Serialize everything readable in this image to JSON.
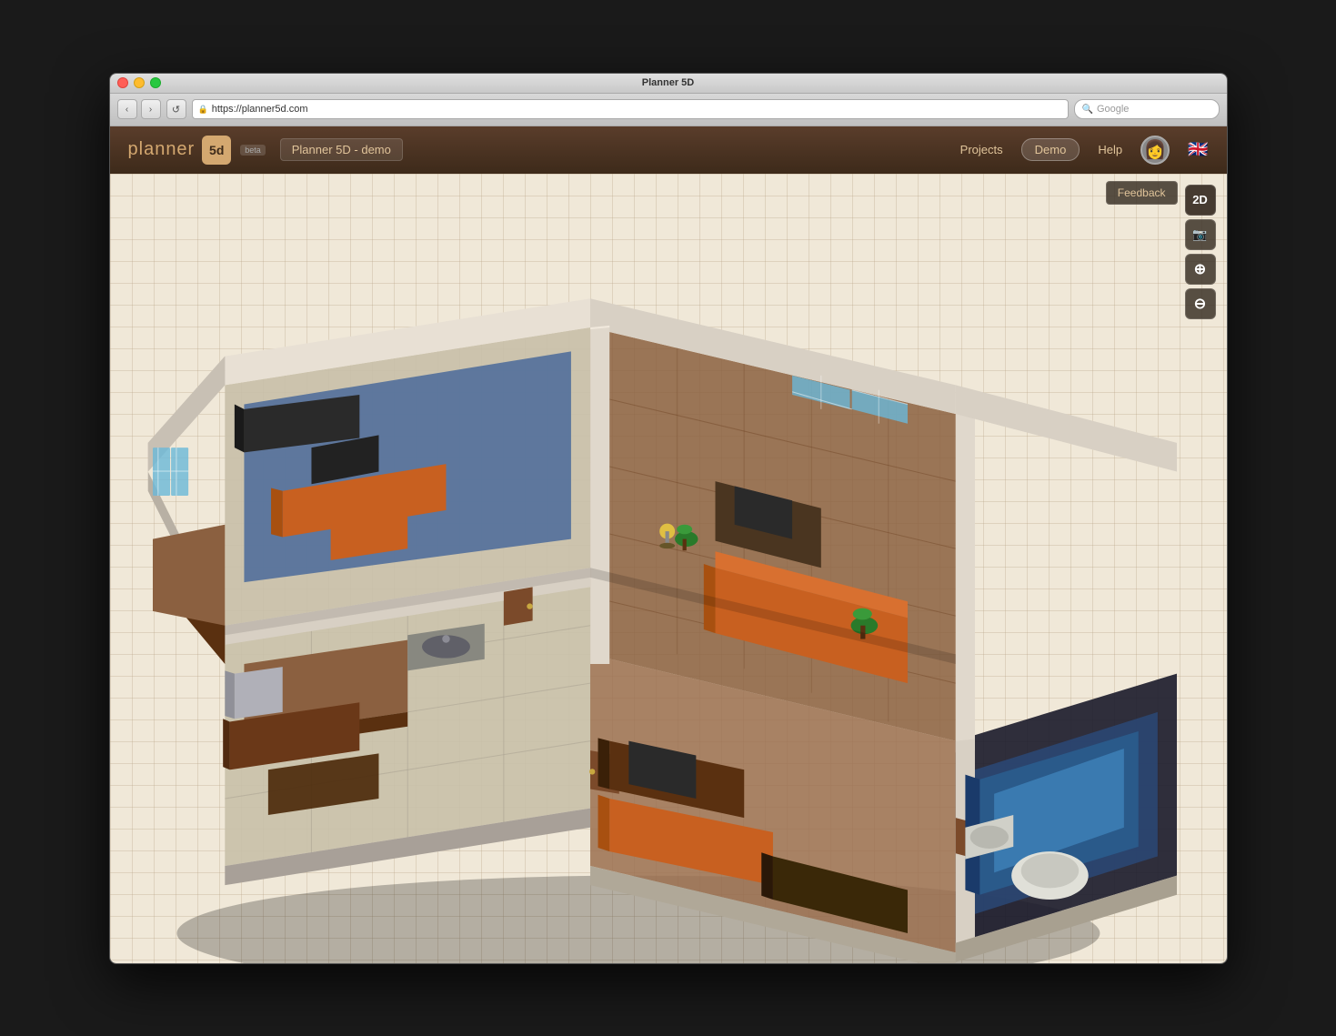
{
  "window": {
    "title": "Planner 5D",
    "buttons": {
      "close": "close",
      "minimize": "minimize",
      "maximize": "maximize"
    }
  },
  "browser": {
    "back_label": "‹",
    "forward_label": "›",
    "reload_label": "↺",
    "url": "https://planner5d.com",
    "search_placeholder": "Google",
    "lock_icon": "🔒"
  },
  "header": {
    "logo_text": "planner",
    "logo_icon": "5d",
    "beta_label": "beta",
    "project_name": "Planner 5D - demo",
    "nav": {
      "projects_label": "Projects",
      "demo_label": "Demo",
      "help_label": "Help"
    },
    "flag": "🇬🇧"
  },
  "canvas": {
    "feedback_label": "Feedback",
    "view_2d_label": "2D",
    "screenshot_icon": "📷",
    "zoom_in_icon": "🔍+",
    "zoom_out_icon": "🔍-"
  }
}
